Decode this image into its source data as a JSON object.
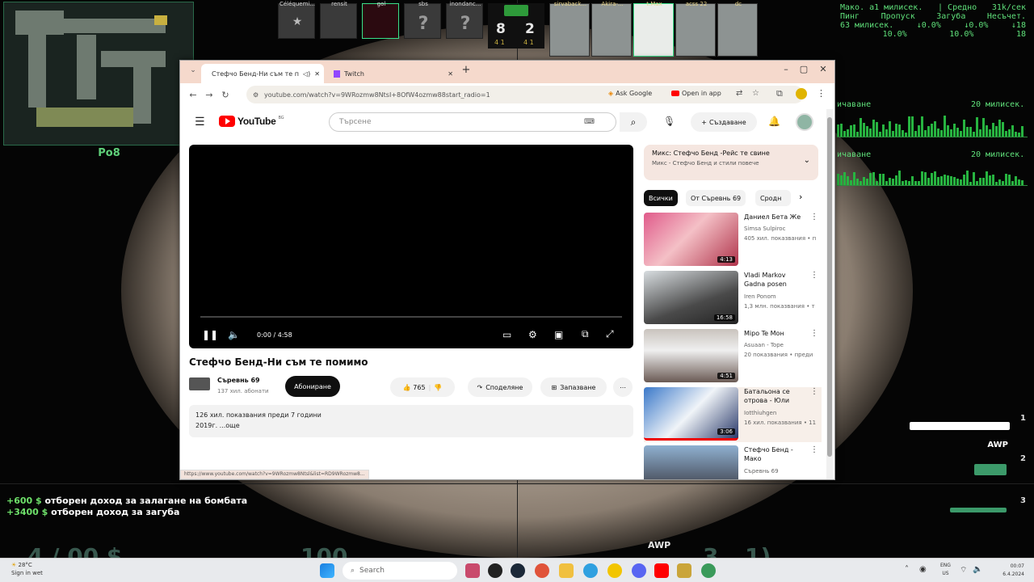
{
  "game": {
    "map_label": "Po8",
    "team_t": [
      {
        "name": "Céléquemi..."
      },
      {
        "name": "rensit"
      },
      {
        "name": "gol"
      },
      {
        "name": "sbs"
      },
      {
        "name": "inondanc..."
      }
    ],
    "team_ct": [
      {
        "name": "sirvaback..."
      },
      {
        "name": "Akira-..."
      },
      {
        "name": "t.Max"
      },
      {
        "name": "acss 22"
      },
      {
        "name": "dc"
      }
    ],
    "score_t": "8",
    "score_ct": "2",
    "alive_t": "4 1",
    "alive_ct": "4 1",
    "netstats": {
      "line1": [
        "Мако. а1 милисек.",
        "| Средно",
        "31k/сек"
      ],
      "line2": [
        "Пинг",
        "Пропуск",
        "Загуба",
        "Несъчет."
      ],
      "line3": [
        "63 милисек.",
        "↓0.0%",
        "↓0.0%",
        "↓18"
      ],
      "line4": [
        "",
        "10.0%",
        "10.0%",
        "18"
      ],
      "graph1_left": "ичаване",
      "graph1_right": "20 милисек.",
      "graph2_left": "ичаване",
      "graph2_right": "20 милисек."
    },
    "money_log": [
      {
        "amount": "+600 $",
        "text": " отборен доход за залагане на бомбата"
      },
      {
        "amount": "+3400 $",
        "text": " отборен доход за загуба"
      }
    ],
    "weapons": {
      "primary": "AWP",
      "slot1": "1",
      "slot2": "2",
      "slot3": "3"
    },
    "hud": {
      "money": "4 / 00 $",
      "health": "100",
      "weapon_name": "AWP",
      "ammo": "3",
      "reserve": "1)"
    }
  },
  "browser": {
    "tabs": [
      {
        "title": "Стефчо Бенд-Ни съм те п"
      },
      {
        "title": "Twitch"
      }
    ],
    "url": "youtube.com/watch?v=9WRozmw8NtsI+8OfW4ozmw88start_radio=1",
    "ask_google": "Ask Google",
    "open_in_app": "Open in app",
    "status_url": "https://www.youtube.com/watch?v=9WRozmw8Ntsl&list=RD9WRozmw8..."
  },
  "youtube": {
    "logo_text": "YouTube",
    "country": "BG",
    "search_placeholder": "Търсене",
    "create_label": "Създаване",
    "time": "0:00 / 4:58",
    "title": "Стефчо Бенд-Ни съм те помимо",
    "channel": "Съревнь 69",
    "subs": "137 хил. абонати",
    "subscribe": "Абониране",
    "likes": "765",
    "share": "Споделяне",
    "save": "Запазване",
    "desc_line1": "126 хил. показвания преди 7 години",
    "desc_line2": "2019г. ...още",
    "now_playing_title": "Микс: Стефчо Бенд -Рейс те свине",
    "now_playing_sub": "Микс - Стефчо Бенд и стили повече",
    "chips": [
      "Всички",
      "От Съревнь 69",
      "Сродн"
    ],
    "recs": [
      {
        "title": "Даниел Бета Же",
        "channel": "Simsa Sulpiroc",
        "meta": "405 хил. показвания • п",
        "duration": "4:13"
      },
      {
        "title": "Vladi Markov Gadna posen",
        "channel": "Iren Ponom",
        "meta": "1,3 млн. показвания • т",
        "duration": "16:58"
      },
      {
        "title": "Mipo Te Мон",
        "channel": "Asuaan - Tope",
        "meta": "20 показвания • преди",
        "duration": "4:51"
      },
      {
        "title": "Батальона се отрова - Юли",
        "channel": "Iotthiuhgen",
        "meta": "16 хил. показвания • 11",
        "duration": "3:06"
      },
      {
        "title": "Стефчо Бенд - Мако",
        "channel": "Съревнь 69",
        "meta": "",
        "duration": ""
      }
    ]
  },
  "taskbar": {
    "weather_temp": "28°C",
    "weather_text": "Sign in wet",
    "search": "Search",
    "lang": "ENG",
    "lang2": "US",
    "time": "00:07",
    "date": "6.4.2024"
  }
}
